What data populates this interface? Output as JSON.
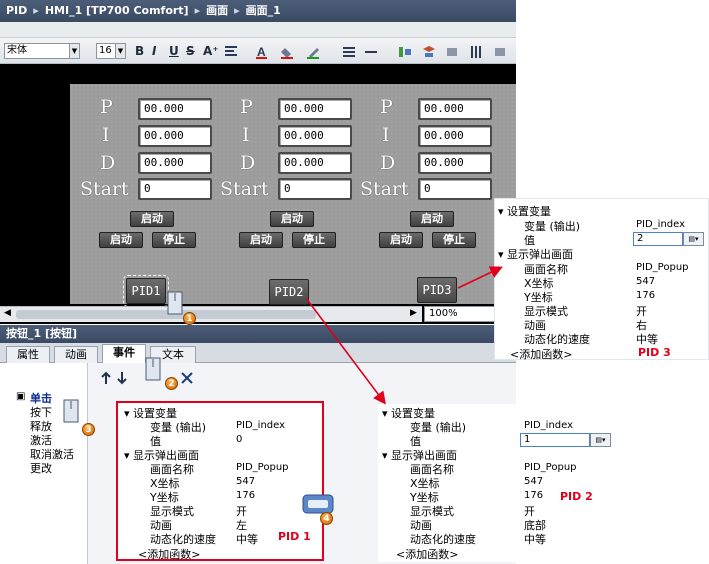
{
  "titlebar": {
    "crumbs": [
      "PID",
      "HMI_1 [TP700 Comfort]",
      "画面",
      "画面_1"
    ]
  },
  "toolbar": {
    "font": "宋体",
    "size": "16",
    "bold": "B",
    "italic": "I",
    "underline": "U",
    "strike": "S",
    "super": "A⁺"
  },
  "canvas": {
    "letters": [
      "P",
      "I",
      "D",
      "Start"
    ],
    "groups": [
      {
        "p": "00.000",
        "i": "00.000",
        "d": "00.000",
        "start": "0",
        "run_top": "启动",
        "run": "启动",
        "stop": "停止"
      },
      {
        "p": "00.000",
        "i": "00.000",
        "d": "00.000",
        "start": "0",
        "run_top": "启动",
        "run": "启动",
        "stop": "停止"
      },
      {
        "p": "00.000",
        "i": "00.000",
        "d": "00.000",
        "start": "0",
        "run_top": "启动",
        "run": "启动",
        "stop": "停止"
      }
    ],
    "buttons": [
      "PID1",
      "PID2",
      "PID3"
    ]
  },
  "zoom": "100%",
  "inspector": {
    "title": "按钮_1 [按钮]",
    "tabs": [
      "属性",
      "动画",
      "事件",
      "文本"
    ],
    "active_tab": "事件",
    "events": [
      "单击",
      "按下",
      "释放",
      "激活",
      "取消激活",
      "更改"
    ]
  },
  "pid1": {
    "rows": [
      {
        "k": "设置变量",
        "v": ""
      },
      {
        "k": "变量 (输出)",
        "v": "PID_index"
      },
      {
        "k": "值",
        "v": "0"
      },
      {
        "k": "显示弹出画面",
        "v": ""
      },
      {
        "k": "画面名称",
        "v": "PID_Popup"
      },
      {
        "k": "X坐标",
        "v": "547"
      },
      {
        "k": "Y坐标",
        "v": "176"
      },
      {
        "k": "显示模式",
        "v": "开"
      },
      {
        "k": "动画",
        "v": "左"
      },
      {
        "k": "动态化的速度",
        "v": "中等"
      }
    ],
    "add": "<添加函数>",
    "label": "PID 1"
  },
  "pid2": {
    "rows": [
      {
        "k": "设置变量",
        "v": ""
      },
      {
        "k": "变量 (输出)",
        "v": "PID_index"
      },
      {
        "k": "值",
        "v": "1"
      },
      {
        "k": "显示弹出画面",
        "v": ""
      },
      {
        "k": "画面名称",
        "v": "PID_Popup"
      },
      {
        "k": "X坐标",
        "v": "547"
      },
      {
        "k": "Y坐标",
        "v": "176"
      },
      {
        "k": "显示模式",
        "v": "开"
      },
      {
        "k": "动画",
        "v": "底部"
      },
      {
        "k": "动态化的速度",
        "v": "中等"
      }
    ],
    "add": "<添加函数>",
    "label": "PID 2"
  },
  "pid3": {
    "rows": [
      {
        "k": "设置变量",
        "v": ""
      },
      {
        "k": "变量 (输出)",
        "v": "PID_index"
      },
      {
        "k": "值",
        "v": "2"
      },
      {
        "k": "显示弹出画面",
        "v": ""
      },
      {
        "k": "画面名称",
        "v": "PID_Popup"
      },
      {
        "k": "X坐标",
        "v": "547"
      },
      {
        "k": "Y坐标",
        "v": "176"
      },
      {
        "k": "显示模式",
        "v": "开"
      },
      {
        "k": "动画",
        "v": "右"
      },
      {
        "k": "动态化的速度",
        "v": "中等"
      }
    ],
    "add": "<添加函数>",
    "label": "PID 3"
  },
  "steps": [
    "1",
    "2",
    "3",
    "4"
  ],
  "colors": {
    "accent_red": "#e0001b",
    "title_bar": "#3b4a63",
    "canvas": "#9c9c9c"
  }
}
